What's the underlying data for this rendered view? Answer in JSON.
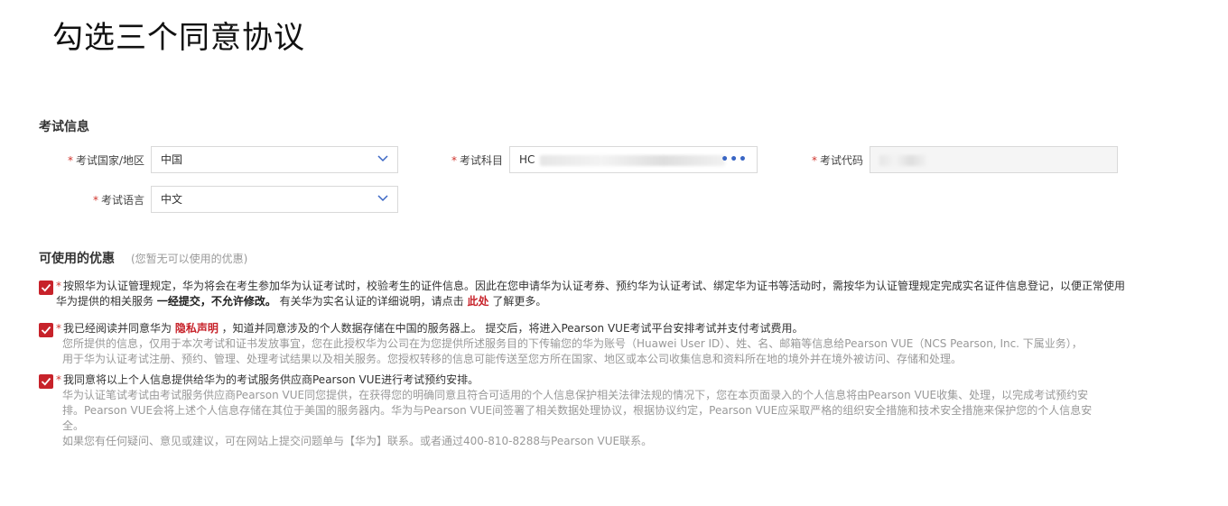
{
  "page_title": "勾选三个同意协议",
  "exam_info": {
    "section_title": "考试信息",
    "country_label": "考试国家/地区",
    "country_value": "中国",
    "subject_label": "考试科目",
    "subject_value_prefix": "HC",
    "subject_more": "•••",
    "code_label": "考试代码",
    "language_label": "考试语言",
    "language_value": "中文",
    "required_mark": "*"
  },
  "discount": {
    "title": "可使用的优惠",
    "hint": "(您暂无可以使用的优惠)"
  },
  "agreements": [
    {
      "line1_a": "按照华为认证管理规定，华为将会在考生参加华为认证考试时，校验考生的证件信息。因此在您申请华为认证考券、预约华为认证考试、绑定华为证书等活动时，需按华为认证管理规定完成实名证件信息登记，以便正常使用华为提供的相关服务 ",
      "bold1": "一经提交，",
      "bold2": "不允许修改。",
      "line1_b": " 有关华为实名认证的详细说明，请点击 ",
      "link": "此处",
      "line1_c": " 了解更多。"
    },
    {
      "main_a": "我已经阅读并同意华为 ",
      "link": "隐私声明",
      "main_b": " ，知道并同意涉及的个人数据存储在中国的服务器上。 提交后，将进入Pearson VUE考试平台安排考试并支付考试费用。",
      "sub1": "您所提供的信息，仅用于本次考试和证书发放事宜，您在此授权华为公司在为您提供所述服务目的下传输您的华为账号（Huawei User ID）、姓、名、邮箱等信息给Pearson VUE（NCS Pearson, Inc. 下属业务），",
      "sub2": "用于华为认证考试注册、预约、管理、处理考试结果以及相关服务。您授权转移的信息可能传送至您方所在国家、地区或本公司收集信息和资料所在地的境外并在境外被访问、存储和处理。"
    },
    {
      "main": "我同意将以上个人信息提供给华为的考试服务供应商Pearson VUE进行考试预约安排。",
      "sub1": "华为认证笔试考试由考试服务供应商Pearson VUE同您提供，在获得您的明确同意且符合可适用的个人信息保护相关法律法规的情况下，您在本页面录入的个人信息将由Pearson VUE收集、处理，以完成考试预约安",
      "sub2": "排。Pearson VUE会将上述个人信息存储在其位于美国的服务器内。华为与Pearson VUE间签署了相关数据处理协议，根据协议约定，Pearson VUE应采取严格的组织安全措施和技术安全措施来保护您的个人信息安",
      "sub3": "全。",
      "sub4": "如果您有任何疑问、意见或建议，可在网站上提交问题单与【华为】联系。或者通过400-810-8288与Pearson VUE联系。"
    }
  ],
  "colors": {
    "accent_red": "#c7222a",
    "link_blue": "#3a66c4",
    "muted_text": "#999999"
  }
}
